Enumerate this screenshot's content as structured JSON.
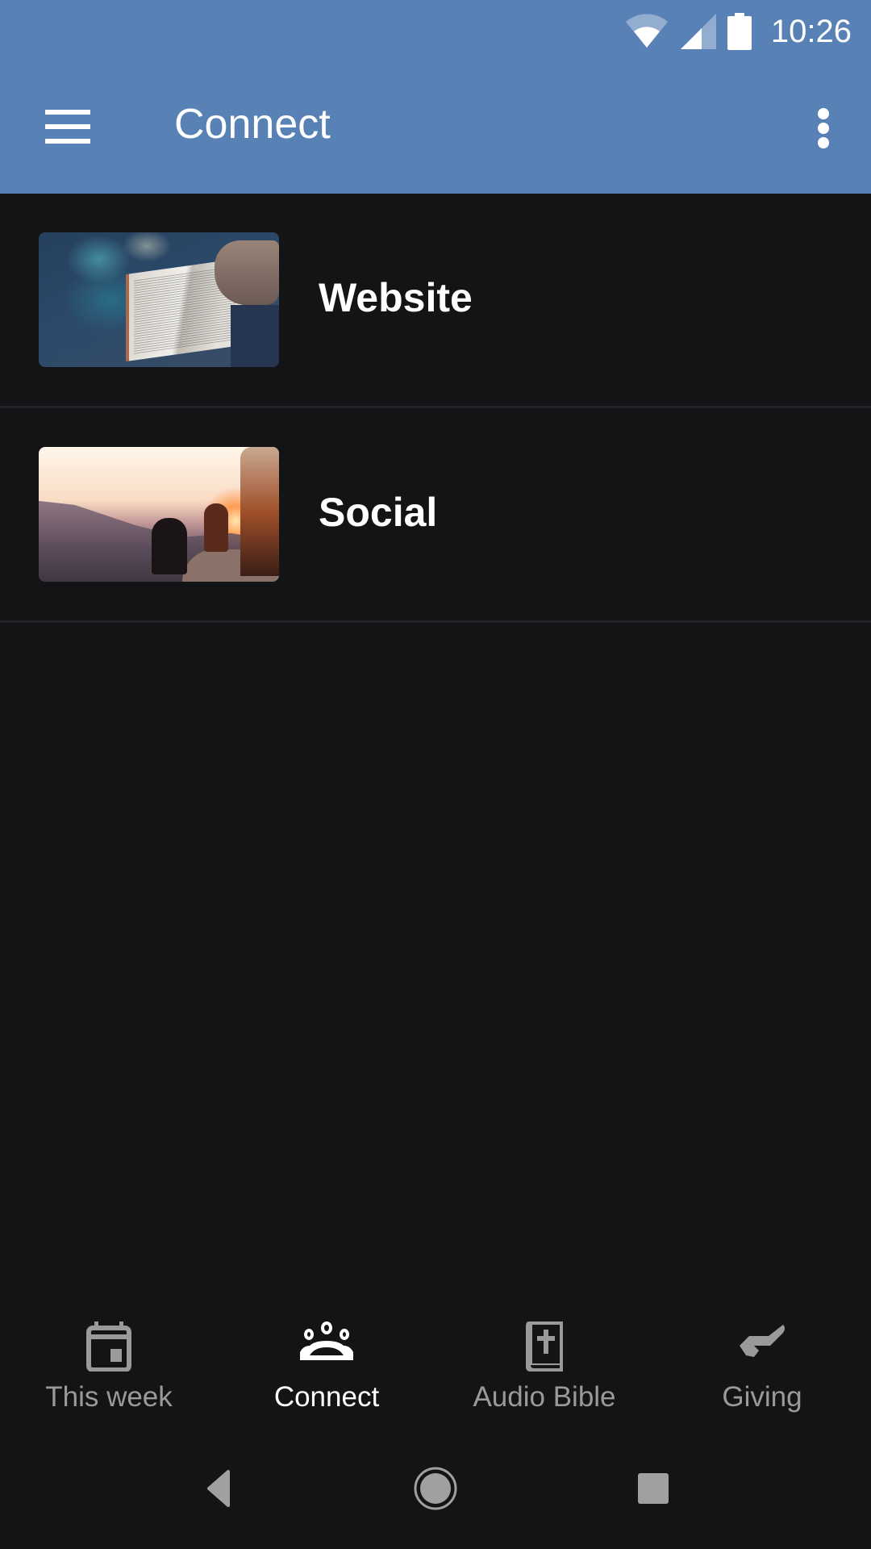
{
  "status_bar": {
    "time": "10:26",
    "icons": [
      "wifi-icon",
      "cell-signal-icon",
      "battery-icon"
    ]
  },
  "app_bar": {
    "title": "Connect",
    "menu_icon": "hamburger-menu-icon",
    "overflow_icon": "more-vert-icon",
    "background": "#5882b6"
  },
  "list": {
    "items": [
      {
        "label": "Website",
        "thumbnail": "open-bible-photo"
      },
      {
        "label": "Social",
        "thumbnail": "sunset-people-photo"
      }
    ]
  },
  "bottom_nav": {
    "tabs": [
      {
        "label": "This week",
        "icon": "calendar-icon",
        "active": false
      },
      {
        "label": "Connect",
        "icon": "group-icon",
        "active": true
      },
      {
        "label": "Audio Bible",
        "icon": "bible-icon",
        "active": false
      },
      {
        "label": "Giving",
        "icon": "giving-hand-icon",
        "active": false
      }
    ]
  },
  "system_nav": {
    "buttons": [
      "back",
      "home",
      "recents"
    ]
  },
  "colors": {
    "background": "#131416",
    "accent": "#5882b6",
    "inactive": "#9a9a9a",
    "active": "#ffffff"
  }
}
